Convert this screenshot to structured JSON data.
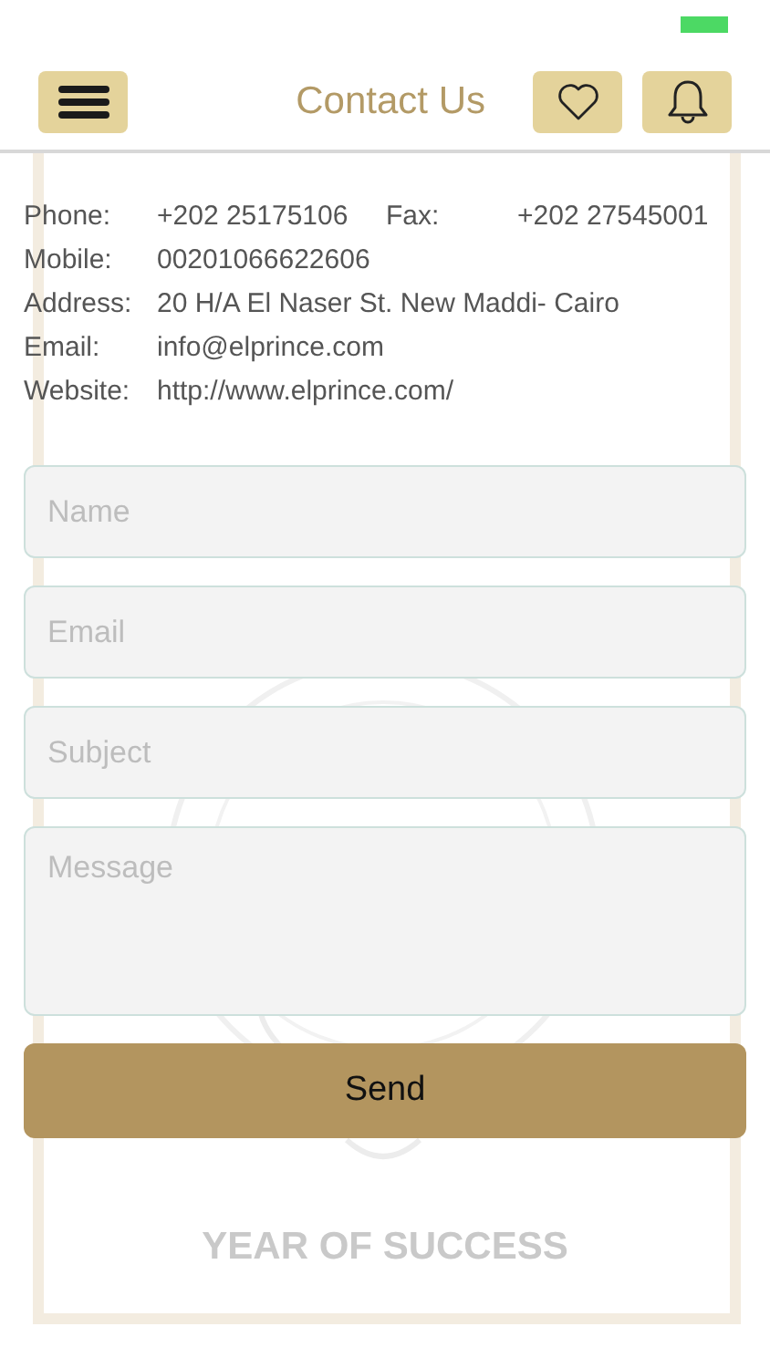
{
  "header": {
    "title": "Contact Us"
  },
  "contact_info": [
    {
      "label": "Phone:",
      "value": "+202 25175106",
      "extra_label": "Fax:",
      "extra_value": "+202 27545001"
    },
    {
      "label": "Mobile:",
      "value": "00201066622606"
    },
    {
      "label": "Address:",
      "value": "20 H/A El Naser St. New Maddi- Cairo"
    },
    {
      "label": "Email:",
      "value": "info@elprince.com"
    },
    {
      "label": "Website:",
      "value": "http://www.elprince.com/"
    }
  ],
  "form": {
    "fields": [
      {
        "placeholder": "Name",
        "kind": "line"
      },
      {
        "placeholder": "Email",
        "kind": "line"
      },
      {
        "placeholder": "Subject",
        "kind": "line"
      },
      {
        "placeholder": "Message",
        "kind": "multiline"
      }
    ],
    "submit": "Send"
  },
  "background_emblem": {
    "caption": "YEAR OF SUCCESS"
  }
}
